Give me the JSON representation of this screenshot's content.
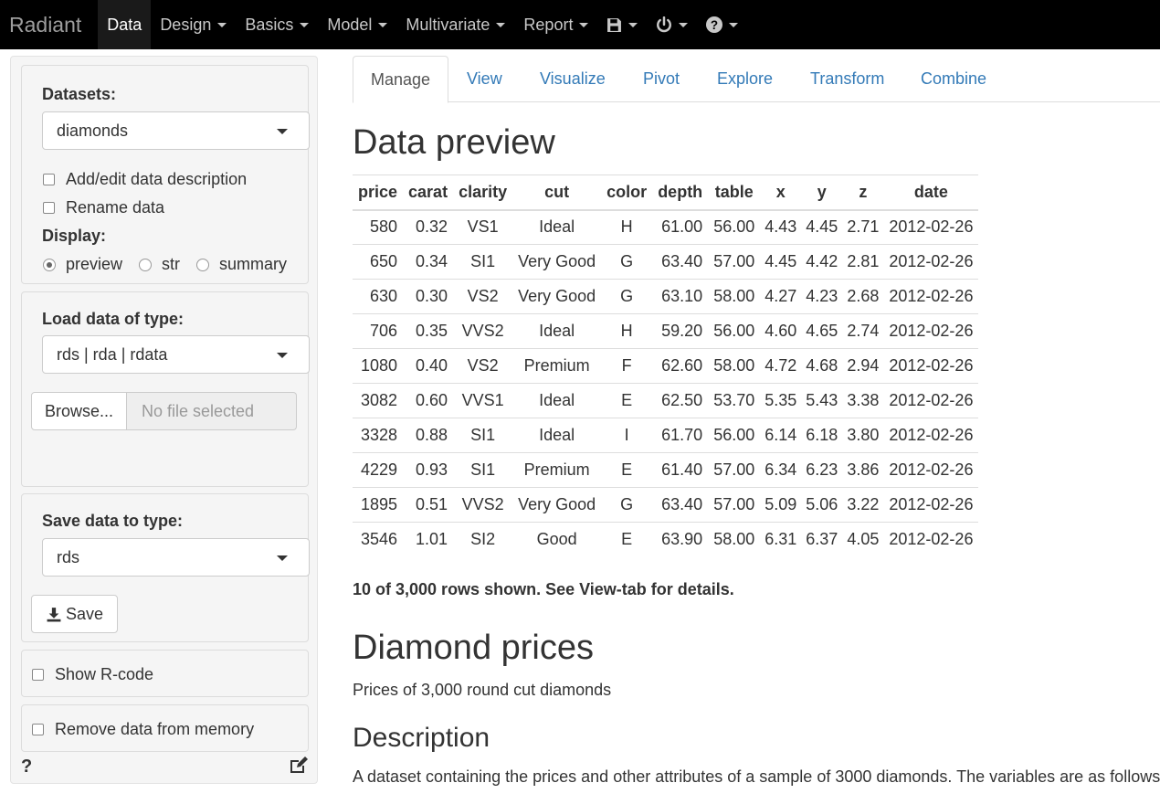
{
  "navbar": {
    "brand": "Radiant",
    "items": [
      "Data",
      "Design",
      "Basics",
      "Model",
      "Multivariate",
      "Report"
    ],
    "active": "Data"
  },
  "icons": {
    "save": "save-icon",
    "power": "power-icon",
    "help": "help-icon",
    "sidebar_help": "question-icon",
    "sidebar_edit": "edit-icon",
    "download": "download-icon"
  },
  "sidebar": {
    "datasets_label": "Datasets:",
    "dataset_value": "diamonds",
    "add_edit_desc": "Add/edit data description",
    "rename_data": "Rename data",
    "display_label": "Display:",
    "display_options": [
      "preview",
      "str",
      "summary"
    ],
    "display_selected": "preview",
    "load_label": "Load data of type:",
    "load_value": "rds | rda | rdata",
    "browse_label": "Browse...",
    "no_file": "No file selected",
    "save_type_label": "Save data to type:",
    "save_type_value": "rds",
    "save_button": "Save",
    "show_rcode": "Show R-code",
    "remove_data": "Remove data from memory",
    "help_mark": "?"
  },
  "tabs": [
    "Manage",
    "View",
    "Visualize",
    "Pivot",
    "Explore",
    "Transform",
    "Combine"
  ],
  "active_tab": "Manage",
  "main": {
    "preview_heading": "Data preview",
    "columns": [
      "price",
      "carat",
      "clarity",
      "cut",
      "color",
      "depth",
      "table",
      "x",
      "y",
      "z",
      "date"
    ],
    "rows": [
      [
        "580",
        "0.32",
        "VS1",
        "Ideal",
        "H",
        "61.00",
        "56.00",
        "4.43",
        "4.45",
        "2.71",
        "2012-02-26"
      ],
      [
        "650",
        "0.34",
        "SI1",
        "Very Good",
        "G",
        "63.40",
        "57.00",
        "4.45",
        "4.42",
        "2.81",
        "2012-02-26"
      ],
      [
        "630",
        "0.30",
        "VS2",
        "Very Good",
        "G",
        "63.10",
        "58.00",
        "4.27",
        "4.23",
        "2.68",
        "2012-02-26"
      ],
      [
        "706",
        "0.35",
        "VVS2",
        "Ideal",
        "H",
        "59.20",
        "56.00",
        "4.60",
        "4.65",
        "2.74",
        "2012-02-26"
      ],
      [
        "1080",
        "0.40",
        "VS2",
        "Premium",
        "F",
        "62.60",
        "58.00",
        "4.72",
        "4.68",
        "2.94",
        "2012-02-26"
      ],
      [
        "3082",
        "0.60",
        "VVS1",
        "Ideal",
        "E",
        "62.50",
        "53.70",
        "5.35",
        "5.43",
        "3.38",
        "2012-02-26"
      ],
      [
        "3328",
        "0.88",
        "SI1",
        "Ideal",
        "I",
        "61.70",
        "56.00",
        "6.14",
        "6.18",
        "3.80",
        "2012-02-26"
      ],
      [
        "4229",
        "0.93",
        "SI1",
        "Premium",
        "E",
        "61.40",
        "57.00",
        "6.34",
        "6.23",
        "3.86",
        "2012-02-26"
      ],
      [
        "1895",
        "0.51",
        "VVS2",
        "Very Good",
        "G",
        "63.40",
        "57.00",
        "5.09",
        "5.06",
        "3.22",
        "2012-02-26"
      ],
      [
        "3546",
        "1.01",
        "SI2",
        "Good",
        "E",
        "63.90",
        "58.00",
        "6.31",
        "6.37",
        "4.05",
        "2012-02-26"
      ]
    ],
    "rows_note": "10 of 3,000 rows shown. See View-tab for details.",
    "title": "Diamond prices",
    "subtitle": "Prices of 3,000 round cut diamonds",
    "description_heading": "Description",
    "description_text": "A dataset containing the prices and other attributes of a sample of 3000 diamonds. The variables are as follows:"
  },
  "colors": {
    "navbar_bg": "#000000",
    "link": "#337ab7",
    "sidebar_bg": "#f5f5f5"
  }
}
